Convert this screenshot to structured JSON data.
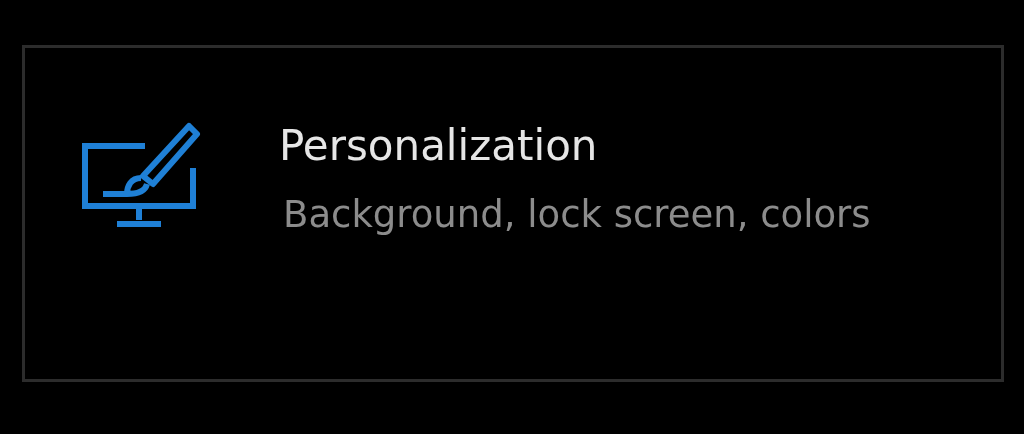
{
  "tile": {
    "title": "Personalization",
    "subtitle": "Background, lock screen, colors"
  }
}
